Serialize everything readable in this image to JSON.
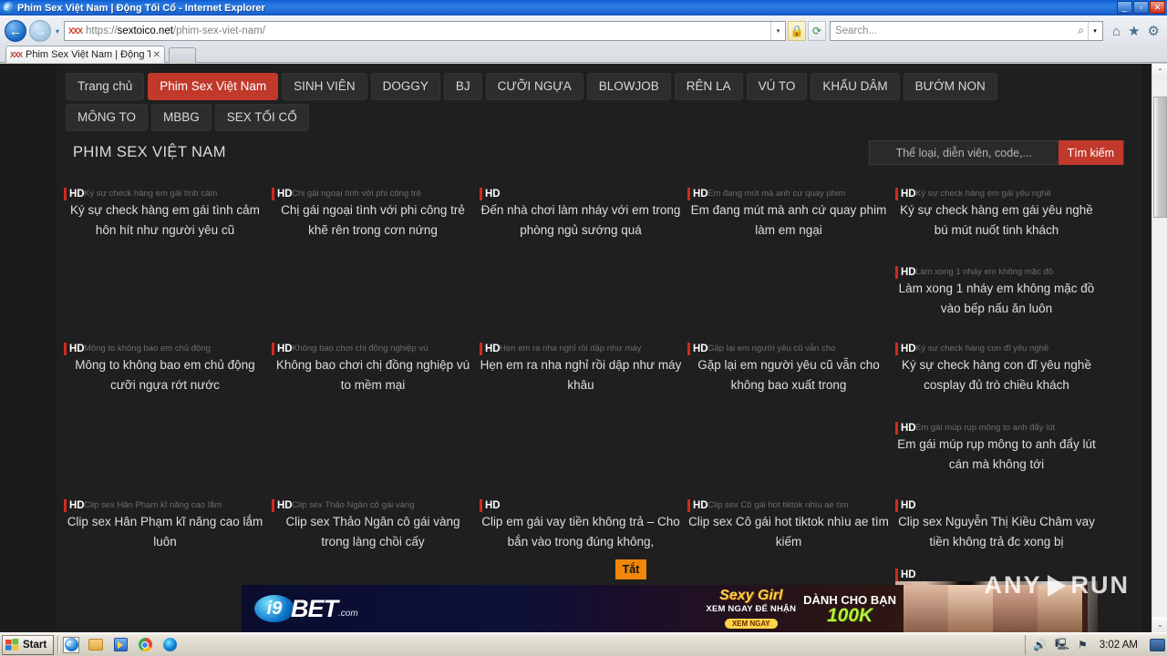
{
  "window": {
    "title": "Phim Sex Việt Nam | Động Tối Cổ - Internet Explorer",
    "minimize": "_",
    "maximize": "▫",
    "close": "✕"
  },
  "browser": {
    "favicon_text": "XXX",
    "url_scheme": "https://",
    "url_host": "sextoico.net",
    "url_path": "/phim-sex-viet-nam/",
    "url_full": "https://sextoico.net/phim-sex-viet-nam/",
    "search_placeholder": "Search...",
    "tab_label": "Phim Sex Việt Nam | Động Tố...",
    "tab_close": "✕",
    "back_icon": "←",
    "forward_icon": "→",
    "recent_icon": "▾",
    "ssl_icon": "🔒",
    "refresh_icon": "⟳",
    "address_dropdown": "▾",
    "search_icon": "⌕",
    "search_dropdown": "▾",
    "home_icon": "⌂",
    "favorites_icon": "★",
    "tools_icon": "⚙"
  },
  "site": {
    "nav": [
      {
        "label": "Trang chủ",
        "active": false
      },
      {
        "label": "Phim Sex Việt Nam",
        "active": true
      },
      {
        "label": "SINH VIÊN",
        "active": false
      },
      {
        "label": "DOGGY",
        "active": false
      },
      {
        "label": "BJ",
        "active": false
      },
      {
        "label": "CƯỠI NGỰA",
        "active": false
      },
      {
        "label": "BLOWJOB",
        "active": false
      },
      {
        "label": "RÊN LA",
        "active": false
      },
      {
        "label": "VÚ TO",
        "active": false
      },
      {
        "label": "KHẨU DÂM",
        "active": false
      },
      {
        "label": "BƯỚM NON",
        "active": false
      },
      {
        "label": "MÔNG TO",
        "active": false
      },
      {
        "label": "MBBG",
        "active": false
      },
      {
        "label": "SEX TỐI CỔ",
        "active": false
      }
    ],
    "page_title": "PHIM SEX VIỆT NAM",
    "search": {
      "placeholder": "Thể loại, diễn viên, code,...",
      "button_label": "Tìm kiếm",
      "accent_color": "#c0392b"
    },
    "badge_hd": "HD",
    "videos": [
      {
        "title": "Ký sự check hàng em gái tình cảm hôn hít như người yêu cũ",
        "caption": "Ký sự check hàng em gái tình cảm",
        "badge": "HD"
      },
      {
        "title": "Chị gái ngoại tình với phi công trẻ khẽ rên trong cơn nứng",
        "caption": "Chị gái ngoại tình với phi công trẻ",
        "badge": "HD"
      },
      {
        "title": "Đến nhà chơi làm nháy với em trong phòng ngủ sướng quá",
        "caption": "",
        "badge": "HD"
      },
      {
        "title": "Em đang mút mà anh cứ quay phim làm em ngại",
        "caption": "Em đang mút mà anh cứ quay phim",
        "badge": "HD"
      },
      {
        "title": "Ký sự check hàng em gái yêu nghề bú mút nuốt tinh khách",
        "caption": "Ký sự check hàng em gái yêu nghề",
        "badge": "HD"
      },
      {
        "title": "Làm xong 1 nháy em không mặc đồ vào bếp nấu ăn luôn",
        "caption": "Làm xong 1 nháy em không mặc đồ",
        "badge": "HD"
      },
      {
        "title": "Mông to không bao em chủ động cưỡi ngựa rớt nước",
        "caption": "Mông to không bao em chủ động",
        "badge": "HD"
      },
      {
        "title": "Không bao chơi chị đồng nghiệp vú to mềm mại",
        "caption": "Không bao chơi chị đồng nghiệp vú",
        "badge": "HD"
      },
      {
        "title": "Hẹn em ra nha nghỉ rồi dập như máy khâu",
        "caption": "Hẹn em ra nha nghỉ rồi dập như máy",
        "badge": "HD"
      },
      {
        "title": "Gặp lại em người yêu cũ vẫn cho không bao xuất trong",
        "caption": "Gặp lại em người yêu cũ vẫn cho",
        "badge": "HD"
      },
      {
        "title": "Ký sự check hàng con đĩ yêu nghề cosplay đủ trò chiều khách",
        "caption": "Ký sự check hàng con đĩ yêu nghề",
        "badge": "HD"
      },
      {
        "title": "Em gái múp rụp mông to anh đẩy lút cán mà không tới",
        "caption": "Em gái múp rụp mông to anh đẩy lút",
        "badge": "HD"
      },
      {
        "title": "Clip sex Hân Phạm kĩ năng cao lắm luôn",
        "caption": "Clip sex Hân Phạm kĩ năng cao lắm",
        "badge": "HD"
      },
      {
        "title": "Clip sex Thảo Ngân cô gái vàng trong làng chồi cấy",
        "caption": "Clip sex Thảo Ngân cô gái vàng",
        "badge": "HD"
      },
      {
        "title": "Clip em gái vay tiền không trả – Cho bắn vào trong đúng không,",
        "caption": "",
        "badge": "HD"
      },
      {
        "title": "Clip sex Cô gái hot tiktok nhìu ae tìm kiếm",
        "caption": "Clip sex Cô gái hot tiktok nhìu ae tìm",
        "badge": "HD"
      },
      {
        "title": "Clip sex Nguyễn Thị Kiều Châm vay tiền không trả đc xong bị",
        "caption": "",
        "badge": "HD"
      },
      {
        "title": "",
        "caption": "",
        "badge": "HD"
      }
    ]
  },
  "ad": {
    "close_label": "Tắt",
    "brand_i9": "i9",
    "brand_bet": "BET",
    "brand_dotcom": ".com",
    "sexy_line1": "Sexy Girl",
    "sexy_line2": "XEM NGAY ĐỂ NHẬN",
    "sexy_cta": "XEM NGAY",
    "offer_line1": "DÀNH CHO BẠN",
    "offer_amount": "100K"
  },
  "watermark": {
    "left": "ANY",
    "right": "RUN"
  },
  "scrollbar": {
    "up": "⌃",
    "down": "⌄"
  },
  "taskbar": {
    "start_label": "Start",
    "quick_launch": [
      "ie-icon",
      "folder-icon",
      "media-player-icon",
      "chrome-icon",
      "edge-icon"
    ],
    "tray_icons": [
      "volume-icon",
      "network-icon",
      "flag-icon"
    ],
    "clock": "3:02 AM",
    "show_desktop": "monitor-icon"
  }
}
